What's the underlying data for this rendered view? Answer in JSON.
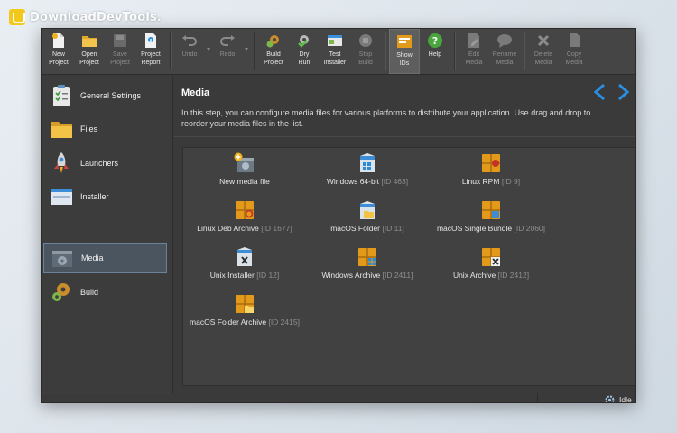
{
  "watermark": {
    "text": "DownloadDevTools."
  },
  "toolbar": {
    "buttons": [
      {
        "label": "New\nProject",
        "icon": "new-project-icon",
        "enabled": true
      },
      {
        "label": "Open\nProject",
        "icon": "folder-icon",
        "enabled": true
      },
      {
        "label": "Save\nProject",
        "icon": "save-icon",
        "enabled": false
      },
      {
        "label": "Project\nReport",
        "icon": "report-icon",
        "enabled": true
      },
      {
        "label": "Undo",
        "icon": "undo-icon",
        "enabled": false
      },
      {
        "label": "Redo",
        "icon": "redo-icon",
        "enabled": false
      },
      {
        "label": "Build\nProject",
        "icon": "build-gear-icon",
        "enabled": true
      },
      {
        "label": "Dry\nRun",
        "icon": "dry-run-gear-icon",
        "enabled": true
      },
      {
        "label": "Test\nInstaller",
        "icon": "test-installer-icon",
        "enabled": true
      },
      {
        "label": "Stop\nBuild",
        "icon": "stop-icon",
        "enabled": false
      },
      {
        "label": "Show\nIDs",
        "icon": "show-ids-icon",
        "enabled": true,
        "active": true
      },
      {
        "label": "Help",
        "icon": "help-icon",
        "enabled": true
      },
      {
        "label": "Edit\nMedia",
        "icon": "edit-icon",
        "enabled": false
      },
      {
        "label": "Rename\nMedia",
        "icon": "rename-icon",
        "enabled": false
      },
      {
        "label": "Delete\nMedia",
        "icon": "delete-icon",
        "enabled": false
      },
      {
        "label": "Copy\nMedia",
        "icon": "copy-icon",
        "enabled": false
      }
    ]
  },
  "sidebar": {
    "items": [
      {
        "label": "General Settings",
        "icon": "checklist-icon"
      },
      {
        "label": "Files",
        "icon": "folder-icon"
      },
      {
        "label": "Launchers",
        "icon": "rocket-icon"
      },
      {
        "label": "Installer",
        "icon": "installer-window-icon"
      },
      {
        "label": "Media",
        "icon": "media-box-icon",
        "selected": true
      },
      {
        "label": "Build",
        "icon": "build-gears-icon"
      }
    ]
  },
  "main": {
    "title": "Media",
    "description": "In this step, you can configure media files for various platforms to distribute your application. Use drag and drop to reorder your media files in the list.",
    "media": [
      {
        "name": "New media file",
        "id": "",
        "icon": "new-media-icon"
      },
      {
        "name": "Windows 64-bit",
        "id": "[ID 463]",
        "icon": "windows-installer-icon"
      },
      {
        "name": "Linux RPM",
        "id": "[ID 9]",
        "icon": "rpm-package-icon"
      },
      {
        "name": "Linux Deb Archive",
        "id": "[ID 1677]",
        "icon": "deb-package-icon"
      },
      {
        "name": "macOS Folder",
        "id": "[ID 11]",
        "icon": "macos-folder-icon"
      },
      {
        "name": "macOS Single Bundle",
        "id": "[ID 2060]",
        "icon": "macos-bundle-icon"
      },
      {
        "name": "Unix Installer",
        "id": "[ID 12]",
        "icon": "unix-installer-icon"
      },
      {
        "name": "Windows Archive",
        "id": "[ID 2411]",
        "icon": "windows-archive-icon"
      },
      {
        "name": "Unix Archive",
        "id": "[ID 2412]",
        "icon": "unix-archive-icon"
      },
      {
        "name": "macOS Folder Archive",
        "id": "[ID 2415]",
        "icon": "macos-archive-icon"
      }
    ]
  },
  "status": {
    "text": "Idle",
    "icon": "gear-status-icon"
  },
  "colors": {
    "accent_blue": "#2a8fe0",
    "package_orange": "#e39a1b",
    "selection": "#4b5560"
  }
}
